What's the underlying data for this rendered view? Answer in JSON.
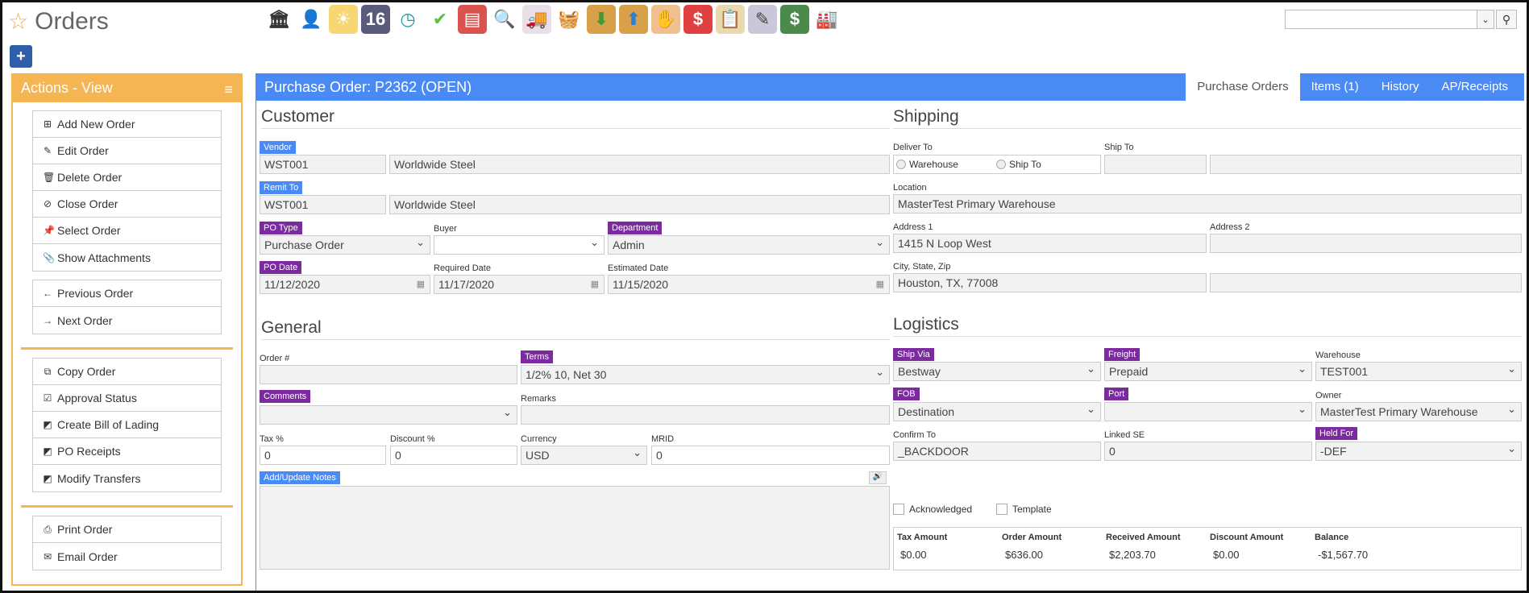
{
  "page": {
    "title": "Orders"
  },
  "toolbar": {
    "icons": [
      {
        "name": "bank-icon",
        "glyph": "🏛",
        "bg": "#ffffff",
        "fg": "#333333"
      },
      {
        "name": "person-icon",
        "glyph": "👤",
        "bg": "#ffffff",
        "fg": "#2f5fa8"
      },
      {
        "name": "weather-icon",
        "glyph": "☀",
        "bg": "#f7d774",
        "fg": "#ffffff"
      },
      {
        "name": "calendar-16-icon",
        "glyph": "16",
        "bg": "#5a5a7a",
        "fg": "#ffffff"
      },
      {
        "name": "clock-icon",
        "glyph": "◷",
        "bg": "#ffffff",
        "fg": "#1a9aa0"
      },
      {
        "name": "checkmark-icon",
        "glyph": "✔",
        "bg": "#ffffff",
        "fg": "#5fbf3f"
      },
      {
        "name": "ledger-icon",
        "glyph": "▤",
        "bg": "#d9534f",
        "fg": "#ffffff"
      },
      {
        "name": "magnifier-icon",
        "glyph": "🔍",
        "bg": "#ffffff",
        "fg": "#2f5fa8"
      },
      {
        "name": "truck-icon",
        "glyph": "🚚",
        "bg": "#e8dfe8",
        "fg": "#c03030"
      },
      {
        "name": "basket-icon",
        "glyph": "🧺",
        "bg": "#ffffff",
        "fg": "#5fbf3f"
      },
      {
        "name": "box-in-icon",
        "glyph": "⬇",
        "bg": "#d9a04a",
        "fg": "#3c9a3c"
      },
      {
        "name": "box-out-icon",
        "glyph": "⬆",
        "bg": "#d9a04a",
        "fg": "#2f7fd0"
      },
      {
        "name": "hand-box-icon",
        "glyph": "✋",
        "bg": "#f0c090",
        "fg": "#ffffff"
      },
      {
        "name": "dollar-chat-icon",
        "glyph": "$",
        "bg": "#e04040",
        "fg": "#ffffff"
      },
      {
        "name": "clipboard-icon",
        "glyph": "📋",
        "bg": "#e8d9b0",
        "fg": "#555555"
      },
      {
        "name": "pencil-pad-icon",
        "glyph": "✎",
        "bg": "#c8c8d8",
        "fg": "#444444"
      },
      {
        "name": "money-icon",
        "glyph": "$",
        "bg": "#4a8a4a",
        "fg": "#ffffff"
      },
      {
        "name": "factory-icon",
        "glyph": "🏭",
        "bg": "#ffffff",
        "fg": "#c03030"
      }
    ]
  },
  "sidebar": {
    "title": "Actions - View",
    "group1": [
      {
        "label": "Add New Order",
        "icon": "⊞",
        "name": "add-new-order-button",
        "iname": "plus-square-icon"
      },
      {
        "label": "Edit Order",
        "icon": "✎",
        "name": "edit-order-button",
        "iname": "pencil-icon"
      },
      {
        "label": "Delete Order",
        "icon": "🗑",
        "name": "delete-order-button",
        "iname": "trash-icon"
      },
      {
        "label": "Close Order",
        "icon": "⊘",
        "name": "close-order-button",
        "iname": "ban-icon"
      },
      {
        "label": "Select Order",
        "icon": "📌",
        "name": "select-order-button",
        "iname": "pin-icon"
      },
      {
        "label": "Show Attachments",
        "icon": "📎",
        "name": "show-attachments-button",
        "iname": "paperclip-icon"
      }
    ],
    "group2": [
      {
        "label": "Previous Order",
        "icon": "←",
        "name": "previous-order-button",
        "iname": "arrow-left-icon"
      },
      {
        "label": "Next Order",
        "icon": "→",
        "name": "next-order-button",
        "iname": "arrow-right-icon"
      }
    ],
    "group3": [
      {
        "label": "Copy Order",
        "icon": "⧉",
        "name": "copy-order-button",
        "iname": "copy-icon"
      },
      {
        "label": "Approval Status",
        "icon": "☑",
        "name": "approval-status-button",
        "iname": "check-square-icon"
      },
      {
        "label": "Create Bill of Lading",
        "icon": "◩",
        "name": "create-bill-of-lading-button",
        "iname": "external-link-icon"
      },
      {
        "label": "PO Receipts",
        "icon": "◩",
        "name": "po-receipts-button",
        "iname": "external-link-icon"
      },
      {
        "label": "Modify Transfers",
        "icon": "◩",
        "name": "modify-transfers-button",
        "iname": "external-link-icon"
      }
    ],
    "group4": [
      {
        "label": "Print Order",
        "icon": "⎙",
        "name": "print-order-button",
        "iname": "printer-icon"
      },
      {
        "label": "Email Order",
        "icon": "✉",
        "name": "email-order-button",
        "iname": "envelope-icon"
      }
    ]
  },
  "main": {
    "title": "Purchase Order: P2362 (OPEN)",
    "tabs": [
      "Purchase Orders",
      "Items (1)",
      "History",
      "AP/Receipts"
    ],
    "customer": {
      "heading": "Customer",
      "vendor_label": "Vendor",
      "vendor_code": "WST001",
      "vendor_name": "Worldwide Steel",
      "remit_label": "Remit To",
      "remit_code": "WST001",
      "remit_name": "Worldwide Steel",
      "po_type_label": "PO Type",
      "po_type": "Purchase Order",
      "buyer_label": "Buyer",
      "buyer": "",
      "department_label": "Department",
      "department": "Admin",
      "po_date_label": "PO Date",
      "po_date": "11/12/2020",
      "required_date_label": "Required Date",
      "required_date": "11/17/2020",
      "estimated_date_label": "Estimated Date",
      "estimated_date": "11/15/2020"
    },
    "general": {
      "heading": "General",
      "order_no_label": "Order #",
      "order_no": "",
      "terms_label": "Terms",
      "terms": "1/2% 10, Net 30",
      "comments_label": "Comments",
      "comments": "",
      "remarks_label": "Remarks",
      "remarks": "",
      "tax_label": "Tax %",
      "tax": "0",
      "discount_label": "Discount %",
      "discount": "0",
      "currency_label": "Currency",
      "currency": "USD",
      "mrid_label": "MRID",
      "mrid": "0",
      "notes_label": "Add/Update Notes"
    },
    "shipping": {
      "heading": "Shipping",
      "deliver_to_label": "Deliver To",
      "radio_warehouse": "Warehouse",
      "radio_ship_to": "Ship To",
      "ship_to_label": "Ship To",
      "location_label": "Location",
      "location": "MasterTest Primary Warehouse",
      "address1_label": "Address 1",
      "address1": "1415 N Loop West",
      "address2_label": "Address 2",
      "address2": "",
      "csz_label": "City, State, Zip",
      "csz": "Houston, TX, 77008"
    },
    "logistics": {
      "heading": "Logistics",
      "ship_via_label": "Ship Via",
      "ship_via": "Bestway",
      "freight_label": "Freight",
      "freight": "Prepaid",
      "warehouse_label": "Warehouse",
      "warehouse": "TEST001",
      "fob_label": "FOB",
      "fob": "Destination",
      "port_label": "Port",
      "port": "",
      "owner_label": "Owner",
      "owner": "MasterTest Primary Warehouse",
      "confirm_to_label": "Confirm To",
      "confirm_to": "_BACKDOOR",
      "linked_se_label": "Linked SE",
      "linked_se": "0",
      "held_for_label": "Held For",
      "held_for": "-DEF",
      "acknowledged_label": "Acknowledged",
      "template_label": "Template"
    },
    "totals": {
      "tax_amount_label": "Tax Amount",
      "tax_amount": "$0.00",
      "order_amount_label": "Order Amount",
      "order_amount": "$636.00",
      "received_amount_label": "Received Amount",
      "received_amount": "$2,203.70",
      "discount_amount_label": "Discount Amount",
      "discount_amount": "$0.00",
      "balance_label": "Balance",
      "balance": "-$1,567.70"
    }
  }
}
